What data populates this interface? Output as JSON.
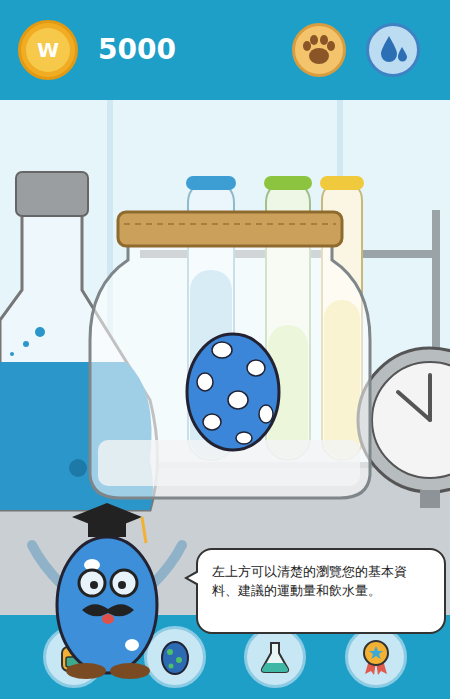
{
  "top_bar": {
    "coin_symbol": "W",
    "coins": "5000"
  },
  "dialog": {
    "text": "左上方可以清楚的瀏覽您的基本資料、建議的運動量和飲水量。"
  }
}
